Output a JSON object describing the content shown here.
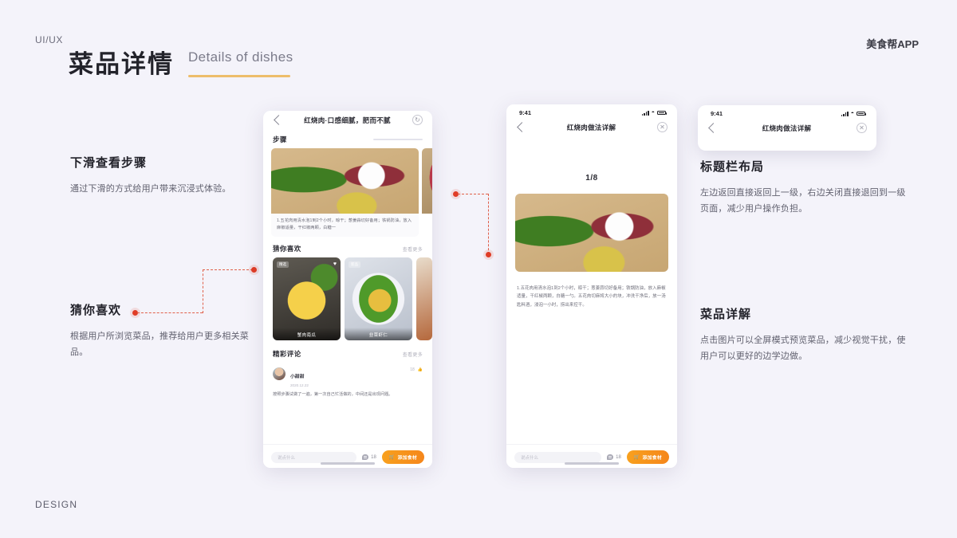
{
  "header": {
    "kicker": "UI/UX",
    "title_cn": "菜品详情",
    "title_en": "Details of dishes",
    "brand": "美食帮APP",
    "accent_color": "#edbd6a"
  },
  "footer": {
    "label": "DESIGN"
  },
  "annotations": [
    {
      "id": "scroll-steps",
      "heading": "下滑查看步骤",
      "body": "通过下滑的方式给用户带来沉浸式体验。"
    },
    {
      "id": "guess-you-like",
      "heading": "猜你喜欢",
      "body": "根据用户所浏览菜品，推荐给用户更多相关菜品。"
    },
    {
      "id": "titlebar-layout",
      "heading": "标题栏布局",
      "body": "左边返回直接返回上一级，右边关闭直接退回到一级页面，减少用户操作负担。"
    },
    {
      "id": "dish-detail",
      "heading": "菜品详解",
      "body": "点击图片可以全屏模式预览菜品，减少视觉干扰，使用户可以更好的边学边做。"
    }
  ],
  "connector": {
    "color": "#e03c26",
    "dash_color": "#e0604a"
  },
  "phone1": {
    "nav_title": "红烧肉·口感细腻，肥而不腻",
    "nav_back_icon": "chevron-left-icon",
    "nav_action_icon": "refresh-icon",
    "steps_section": {
      "title": "步骤"
    },
    "step_caption": "1.五花肉用清水泡1到2个小时，晾干；葱姜蒜切好备用；铁锅防油，放入麻椒适量，干红椒两颗，白糖一",
    "guess_section": {
      "title": "猜你喜欢",
      "more": "查看更多"
    },
    "guess_cards": [
      {
        "label": "蟹肉南瓜",
        "badge": "精选",
        "heart": "♥"
      },
      {
        "label": "韭菜虾仁",
        "badge": "新品",
        "heart": ""
      }
    ],
    "comment_section": {
      "title": "精彩评论",
      "more": "查看更多"
    },
    "comment": {
      "user": "小甜甜",
      "date": "2020.12.22",
      "likes": "18",
      "text": "按照步骤试做了一遍，第一次自己忙活做的，中间还是出现问题。"
    },
    "bottombar": {
      "placeholder": "说点什么",
      "comment_count": "18",
      "add_label": "添加食材",
      "add_icon": "cart-icon"
    }
  },
  "phone2": {
    "status": {
      "time": "9:41",
      "signal_icon": "signal-bars-icon",
      "wifi_icon": "wifi-icon",
      "battery_icon": "battery-icon"
    },
    "nav_title": "红烧肉做法详解",
    "nav_back_icon": "chevron-left-icon",
    "nav_close_icon": "close-circle-icon",
    "pager": "1/8",
    "detail_text": "1.五花肉用清水泡1到2个小时，晾干；葱姜蒜切好备用；铁锅防油，放入麻椒适量，干红椒两颗，白糖一勺。五花肉切麻将大小的块，冲洗干净后，放一汤匙料酒，浸泡一小时，捞出来控干。",
    "bottombar": {
      "placeholder": "说点什么",
      "comment_count": "18",
      "add_label": "添加食材",
      "add_icon": "cart-icon"
    }
  },
  "phone3": {
    "status": {
      "time": "9:41"
    },
    "nav_title": "红烧肉做法详解",
    "nav_back_icon": "chevron-left-icon",
    "nav_close_icon": "close-circle-icon"
  }
}
